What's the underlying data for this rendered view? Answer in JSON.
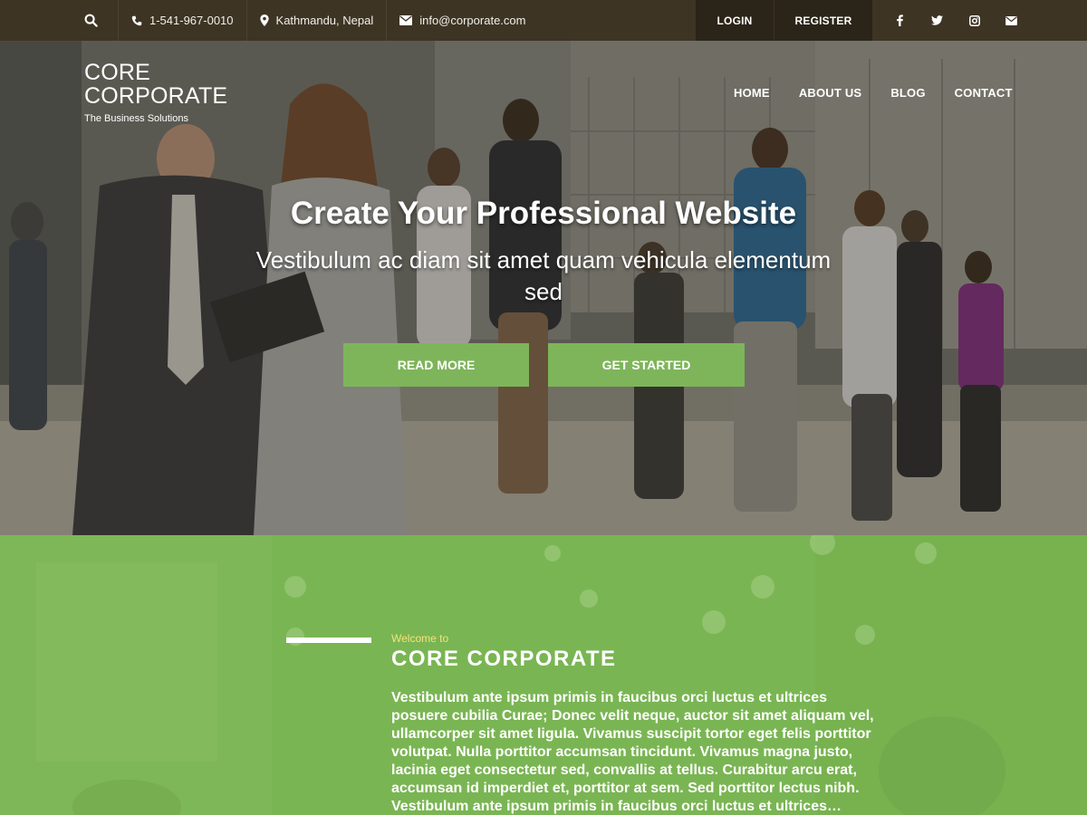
{
  "topbar": {
    "phone": "1-541-967-0010",
    "location": "Kathmandu, Nepal",
    "email": "info@corporate.com",
    "login_label": "LOGIN",
    "register_label": "REGISTER",
    "social_icons": [
      "facebook-icon",
      "twitter-icon",
      "instagram-icon",
      "envelope-icon"
    ]
  },
  "brand": {
    "line1": "CORE",
    "line2": "CORPORATE",
    "tagline": "The Business Solutions"
  },
  "nav": {
    "items": [
      {
        "label": "HOME"
      },
      {
        "label": "ABOUT US"
      },
      {
        "label": "BLOG"
      },
      {
        "label": "CONTACT"
      }
    ]
  },
  "hero": {
    "title": "Create Your Professional Website",
    "subtitle": "Vestibulum ac diam sit amet quam vehicula elementum sed",
    "read_more_label": "READ MORE",
    "get_started_label": "GET STARTED"
  },
  "welcome": {
    "pre_title": "Welcome to",
    "title": "CORE CORPORATE",
    "body": "Vestibulum ante ipsum primis in faucibus orci luctus et ultrices posuere cubilia Curae; Donec velit neque, auctor sit amet aliquam vel, ullamcorper sit amet ligula. Vivamus suscipit tortor eget felis porttitor volutpat. Nulla porttitor accumsan tincidunt. Vivamus magna justo, lacinia eget consectetur sed, convallis at tellus. Curabitur arcu erat, accumsan id imperdiet et, porttitor at sem. Sed porttitor lectus nibh. Vestibulum ante ipsum primis in faucibus orci luctus et ultrices…"
  },
  "colors": {
    "topbar_bg": "#3d3424",
    "accent_green": "#7eb55a",
    "welcome_pre": "#f3e37a"
  }
}
